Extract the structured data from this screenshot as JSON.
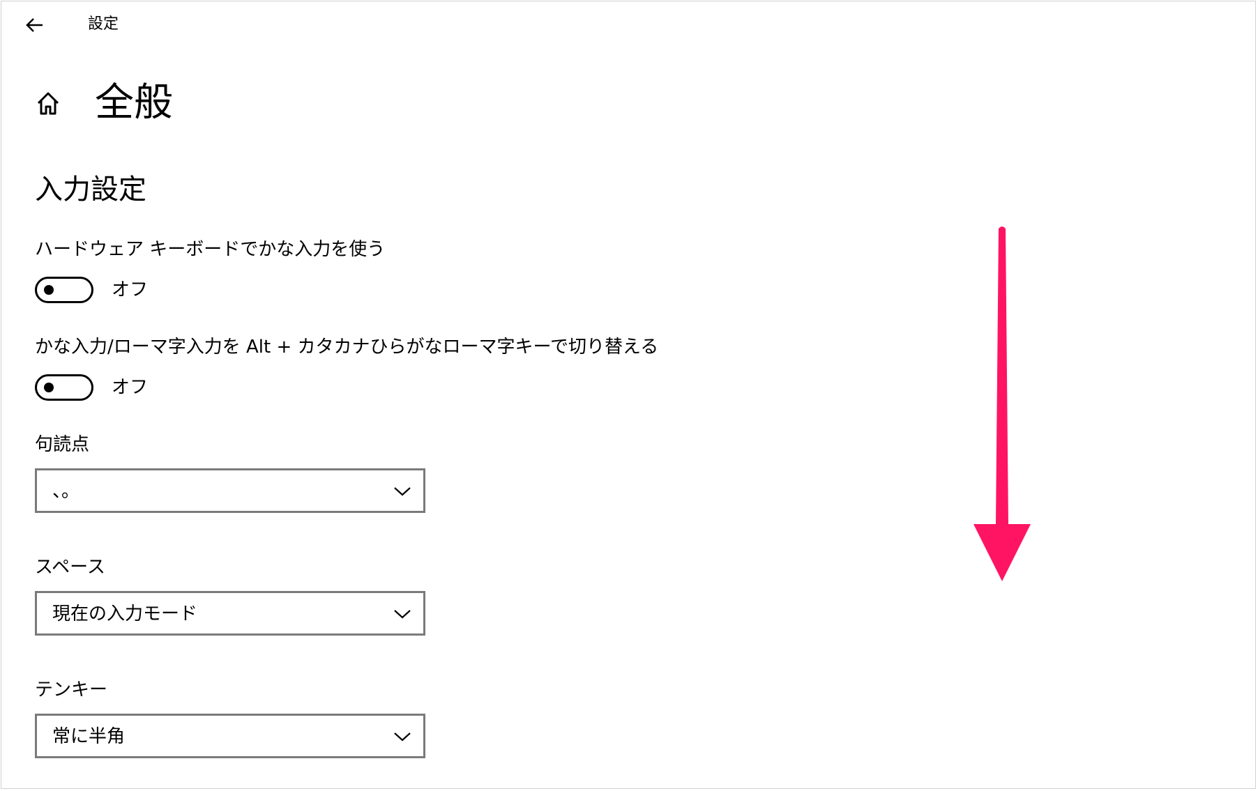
{
  "window": {
    "back_icon": "arrow-left-icon",
    "title": "設定"
  },
  "header": {
    "home_icon": "home-icon",
    "title": "全般"
  },
  "section": {
    "title": "入力設定"
  },
  "settings": {
    "hardware_kana": {
      "label": "ハードウェア キーボードでかな入力を使う",
      "state": "オフ",
      "on": false
    },
    "kana_romaji_switch": {
      "label": "かな入力/ローマ字入力を Alt + カタカナひらがなローマ字キーで切り替える",
      "state": "オフ",
      "on": false
    },
    "punctuation": {
      "label": "句読点",
      "value": "、。"
    },
    "space": {
      "label": "スペース",
      "value": "現在の入力モード"
    },
    "numpad": {
      "label": "テンキー",
      "value": "常に半角"
    }
  },
  "colors": {
    "annotation_arrow": "#ff1464",
    "dropdown_border": "#7a7a7a"
  },
  "annotation": {
    "icon": "down-arrow-icon"
  }
}
